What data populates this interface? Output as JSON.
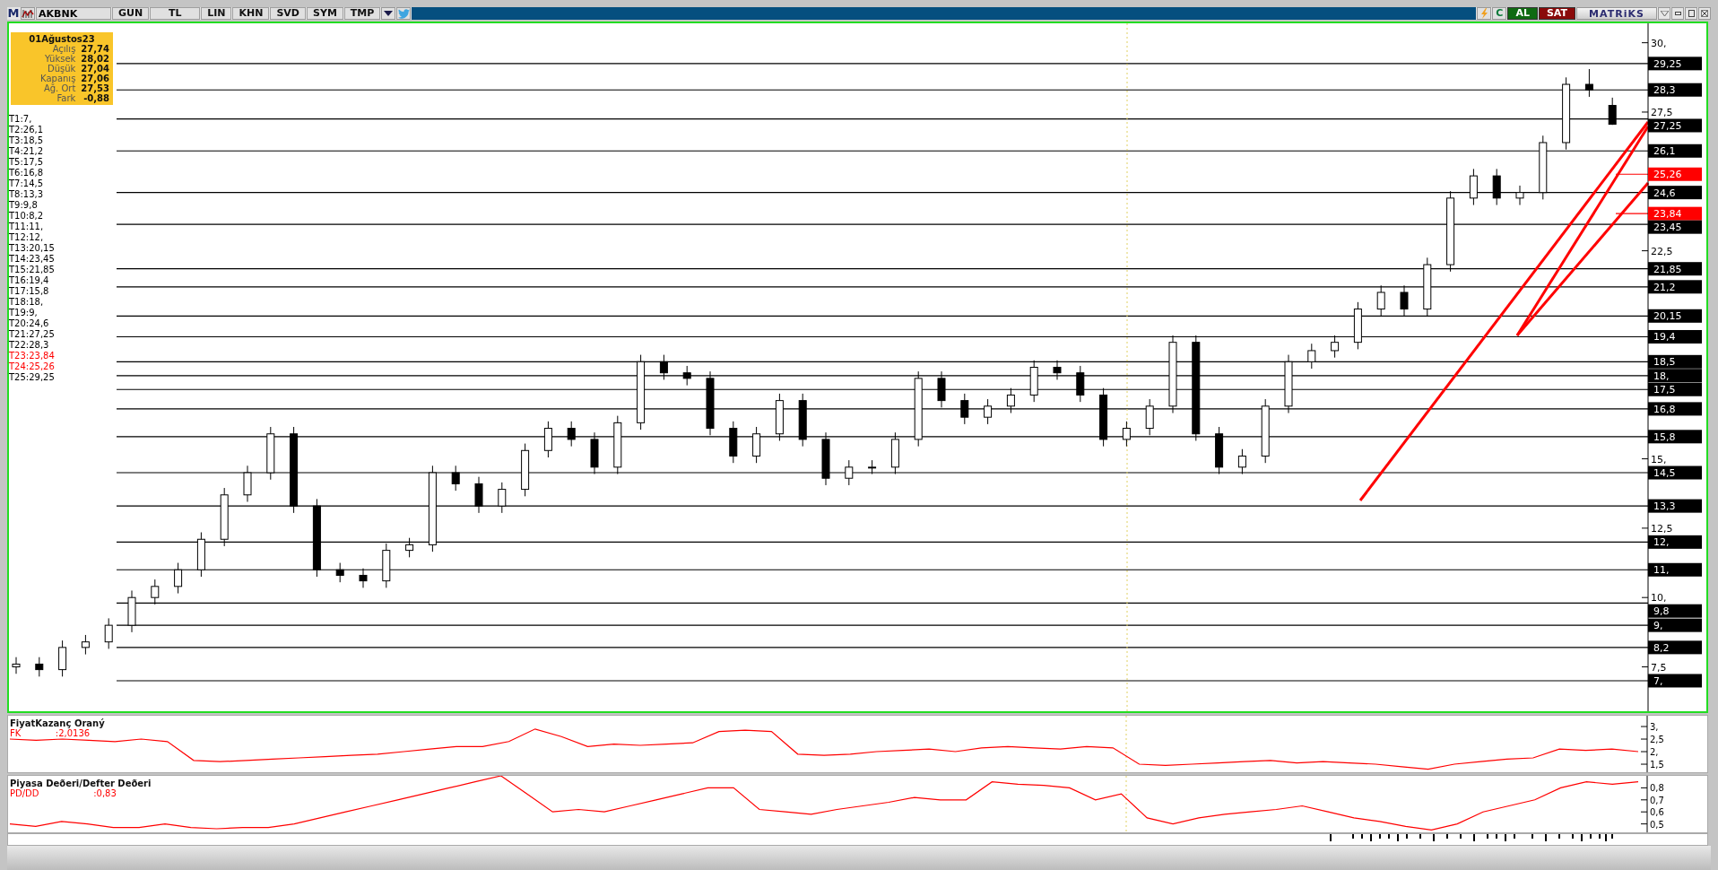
{
  "toolbar": {
    "logo": "M",
    "symbol": "AKBNK",
    "buttons": [
      "GUN",
      "TL",
      "LIN",
      "KHN",
      "SVD",
      "SYM",
      "TMP"
    ],
    "refresh": "C",
    "trade_buttons": [
      {
        "label": "AL",
        "kind": "buy"
      },
      {
        "label": "SAT",
        "kind": "sell"
      }
    ],
    "brand": "MATRiKS"
  },
  "info_box": {
    "date": "01Ağustos23",
    "rows": [
      {
        "label": "Açılış",
        "value": "27,74"
      },
      {
        "label": "Yüksek",
        "value": "28,02"
      },
      {
        "label": "Düşük",
        "value": "27,04"
      },
      {
        "label": "Kapanış",
        "value": "27,06"
      },
      {
        "label": "Ağ. Ort",
        "value": "27,53"
      },
      {
        "label": "Fark",
        "value": "-0,88"
      }
    ]
  },
  "price_chart": {
    "levels": [
      {
        "text": "T1:7,",
        "color": "#000000"
      },
      {
        "text": "T2:26,1",
        "color": "#000000"
      },
      {
        "text": "T3:18,5",
        "color": "#000000"
      },
      {
        "text": "T4:21,2",
        "color": "#000000"
      },
      {
        "text": "T5:17,5",
        "color": "#000000"
      },
      {
        "text": "T6:16,8",
        "color": "#000000"
      },
      {
        "text": "T7:14,5",
        "color": "#000000"
      },
      {
        "text": "T8:13,3",
        "color": "#000000"
      },
      {
        "text": "T9:9,8",
        "color": "#000000"
      },
      {
        "text": "T10:8,2",
        "color": "#000000"
      },
      {
        "text": "T11:11,",
        "color": "#000000"
      },
      {
        "text": "T12:12,",
        "color": "#000000"
      },
      {
        "text": "T13:20,15",
        "color": "#000000"
      },
      {
        "text": "T14:23,45",
        "color": "#000000"
      },
      {
        "text": "T15:21,85",
        "color": "#000000"
      },
      {
        "text": "T16:19,4",
        "color": "#000000"
      },
      {
        "text": "T17:15,8",
        "color": "#000000"
      },
      {
        "text": "T18:18,",
        "color": "#000000"
      },
      {
        "text": "T19:9,",
        "color": "#000000"
      },
      {
        "text": "T20:24,6",
        "color": "#000000"
      },
      {
        "text": "T21:27,25",
        "color": "#000000"
      },
      {
        "text": "T22:28,3",
        "color": "#000000"
      },
      {
        "text": "T23:23,84",
        "color": "#ff0000"
      },
      {
        "text": "T24:25,26",
        "color": "#ff0000"
      },
      {
        "text": "T25:29,25",
        "color": "#000000"
      }
    ],
    "chart_data": {
      "type": "candlestick",
      "ylim": [
        5.9,
        30.7
      ],
      "yticks": [
        {
          "value": 30,
          "label": "30,"
        },
        {
          "value": 27.5,
          "label": "27,5"
        },
        {
          "value": 22.5,
          "label": "22,5"
        },
        {
          "value": 15,
          "label": "15,"
        },
        {
          "value": 12.5,
          "label": "12,5"
        },
        {
          "value": 10,
          "label": "10,"
        },
        {
          "value": 7.5,
          "label": "7,5"
        }
      ],
      "ohlc": [
        [
          7.5,
          7.85,
          7.25,
          7.6
        ],
        [
          7.6,
          7.85,
          7.15,
          7.4
        ],
        [
          7.4,
          8.45,
          7.15,
          8.2
        ],
        [
          8.2,
          8.65,
          7.95,
          8.4
        ],
        [
          8.4,
          9.25,
          8.15,
          9
        ],
        [
          9,
          10.25,
          8.75,
          10
        ],
        [
          10,
          10.65,
          9.75,
          10.4
        ],
        [
          10.4,
          11.25,
          10.15,
          11
        ],
        [
          11,
          12.35,
          10.75,
          12.1
        ],
        [
          12.1,
          13.95,
          11.85,
          13.7
        ],
        [
          13.7,
          14.75,
          13.45,
          14.5
        ],
        [
          14.5,
          16.15,
          14.25,
          15.9
        ],
        [
          15.9,
          16.15,
          13.05,
          13.3
        ],
        [
          13.3,
          13.55,
          10.75,
          11
        ],
        [
          11,
          11.25,
          10.55,
          10.8
        ],
        [
          10.8,
          11.05,
          10.35,
          10.6
        ],
        [
          10.6,
          11.95,
          10.35,
          11.7
        ],
        [
          11.7,
          12.15,
          11.45,
          11.9
        ],
        [
          11.9,
          14.75,
          11.65,
          14.5
        ],
        [
          14.5,
          14.75,
          13.85,
          14.1
        ],
        [
          14.1,
          14.35,
          13.05,
          13.3
        ],
        [
          13.3,
          14.15,
          13.05,
          13.9
        ],
        [
          13.9,
          15.55,
          13.65,
          15.3
        ],
        [
          15.3,
          16.35,
          15.05,
          16.1
        ],
        [
          16.1,
          16.35,
          15.45,
          15.7
        ],
        [
          15.7,
          15.95,
          14.45,
          14.7
        ],
        [
          14.7,
          16.55,
          14.45,
          16.3
        ],
        [
          16.3,
          18.75,
          16.05,
          18.5
        ],
        [
          18.5,
          18.75,
          17.85,
          18.1
        ],
        [
          18.1,
          18.35,
          17.65,
          17.9
        ],
        [
          17.9,
          18.15,
          15.85,
          16.1
        ],
        [
          16.1,
          16.35,
          14.85,
          15.1
        ],
        [
          15.1,
          16.15,
          14.85,
          15.9
        ],
        [
          15.9,
          17.35,
          15.65,
          17.1
        ],
        [
          17.1,
          17.35,
          15.45,
          15.7
        ],
        [
          15.7,
          15.95,
          14.05,
          14.3
        ],
        [
          14.3,
          14.95,
          14.05,
          14.7
        ],
        [
          14.7,
          14.95,
          14.45,
          14.7
        ],
        [
          14.7,
          15.95,
          14.45,
          15.7
        ],
        [
          15.7,
          18.15,
          15.45,
          17.9
        ],
        [
          17.9,
          18.15,
          16.85,
          17.1
        ],
        [
          17.1,
          17.35,
          16.25,
          16.5
        ],
        [
          16.5,
          17.15,
          16.25,
          16.9
        ],
        [
          16.9,
          17.55,
          16.65,
          17.3
        ],
        [
          17.3,
          18.55,
          17.05,
          18.3
        ],
        [
          18.3,
          18.55,
          17.85,
          18.1
        ],
        [
          18.1,
          18.35,
          17.05,
          17.3
        ],
        [
          17.3,
          17.55,
          15.45,
          15.7
        ],
        [
          15.7,
          16.35,
          15.45,
          16.1
        ],
        [
          16.1,
          17.15,
          15.85,
          16.9
        ],
        [
          16.9,
          19.45,
          16.65,
          19.2
        ],
        [
          19.2,
          19.45,
          15.65,
          15.9
        ],
        [
          15.9,
          16.15,
          14.45,
          14.7
        ],
        [
          14.7,
          15.35,
          14.45,
          15.1
        ],
        [
          15.1,
          17.15,
          14.85,
          16.9
        ],
        [
          16.9,
          18.75,
          16.65,
          18.5
        ],
        [
          18.5,
          19.15,
          18.25,
          18.9
        ],
        [
          18.9,
          19.45,
          18.65,
          19.2
        ],
        [
          19.2,
          20.65,
          18.95,
          20.4
        ],
        [
          20.4,
          21.25,
          20.15,
          21
        ],
        [
          21,
          21.25,
          20.15,
          20.4
        ],
        [
          20.4,
          22.25,
          20.15,
          22
        ],
        [
          22,
          24.65,
          21.75,
          24.4
        ],
        [
          24.4,
          25.45,
          24.15,
          25.2
        ],
        [
          25.2,
          25.45,
          24.15,
          24.4
        ],
        [
          24.4,
          24.85,
          24.15,
          24.6
        ],
        [
          24.6,
          26.65,
          24.35,
          26.4
        ],
        [
          26.4,
          28.75,
          26.15,
          28.5
        ],
        [
          28.5,
          29.05,
          28.05,
          28.3
        ],
        [
          27.74,
          28.02,
          27.04,
          27.06
        ]
      ],
      "ref_lines": [
        {
          "axis": "y",
          "value": 7,
          "label": "7,",
          "color": "#000000"
        },
        {
          "axis": "y",
          "value": 26.1,
          "label": "26,1",
          "color": "#000000"
        },
        {
          "axis": "y",
          "value": 18.5,
          "label": "18,5",
          "color": "#000000"
        },
        {
          "axis": "y",
          "value": 21.2,
          "label": "21,2",
          "color": "#000000"
        },
        {
          "axis": "y",
          "value": 17.5,
          "label": "17,5",
          "color": "#000000"
        },
        {
          "axis": "y",
          "value": 16.8,
          "label": "16,8",
          "color": "#000000"
        },
        {
          "axis": "y",
          "value": 14.5,
          "label": "14,5",
          "color": "#000000"
        },
        {
          "axis": "y",
          "value": 13.3,
          "label": "13,3",
          "color": "#000000"
        },
        {
          "axis": "y",
          "value": 9.8,
          "label": "9,8",
          "color": "#000000"
        },
        {
          "axis": "y",
          "value": 8.2,
          "label": "8,2",
          "color": "#000000"
        },
        {
          "axis": "y",
          "value": 11,
          "label": "11,",
          "color": "#000000"
        },
        {
          "axis": "y",
          "value": 12,
          "label": "12,",
          "color": "#000000"
        },
        {
          "axis": "y",
          "value": 20.15,
          "label": "20,15",
          "color": "#000000"
        },
        {
          "axis": "y",
          "value": 23.45,
          "label": "23,45",
          "color": "#000000"
        },
        {
          "axis": "y",
          "value": 21.85,
          "label": "21,85",
          "color": "#000000"
        },
        {
          "axis": "y",
          "value": 19.4,
          "label": "19,4",
          "color": "#000000"
        },
        {
          "axis": "y",
          "value": 15.8,
          "label": "15,8",
          "color": "#000000"
        },
        {
          "axis": "y",
          "value": 18,
          "label": "18,",
          "color": "#000000"
        },
        {
          "axis": "y",
          "value": 9,
          "label": "9,",
          "color": "#000000"
        },
        {
          "axis": "y",
          "value": 24.6,
          "label": "24,6",
          "color": "#000000"
        },
        {
          "axis": "y",
          "value": 27.25,
          "label": "27,25",
          "color": "#000000"
        },
        {
          "axis": "y",
          "value": 28.3,
          "label": "28,3",
          "color": "#000000"
        },
        {
          "axis": "y",
          "value": 23.84,
          "label": "23,84",
          "color": "#ff0000"
        },
        {
          "axis": "y",
          "value": 25.26,
          "label": "25,26",
          "color": "#ff0000"
        },
        {
          "axis": "y",
          "value": 29.25,
          "label": "29,25",
          "color": "#000000"
        }
      ]
    }
  },
  "indicators": [
    {
      "title": "FiyatKazanç Oraný",
      "reading": ":2,0136",
      "chart_data": {
        "type": "line",
        "ylim": [
          1.18,
          3.43
        ],
        "yticks": [
          {
            "value": 3,
            "label": "3,"
          },
          {
            "value": 2.5,
            "label": "2,5"
          },
          {
            "value": 2,
            "label": "2,"
          },
          {
            "value": 1.5,
            "label": "1,5"
          }
        ],
        "series": [
          {
            "name": "FK",
            "color": "#ff0000",
            "values": [
              2.5,
              2.45,
              2.5,
              2.45,
              2.4,
              2.5,
              2.4,
              1.65,
              1.6,
              1.65,
              1.7,
              1.75,
              1.8,
              1.85,
              1.9,
              2.0,
              2.1,
              2.2,
              2.2,
              2.4,
              2.9,
              2.6,
              2.2,
              2.3,
              2.25,
              2.3,
              2.35,
              2.8,
              2.85,
              2.8,
              1.9,
              1.85,
              1.9,
              2.0,
              2.05,
              2.1,
              2.0,
              2.15,
              2.2,
              2.15,
              2.1,
              2.2,
              2.15,
              1.5,
              1.45,
              1.5,
              1.55,
              1.6,
              1.65,
              1.55,
              1.6,
              1.55,
              1.5,
              1.4,
              1.3,
              1.5,
              1.6,
              1.7,
              1.75,
              2.1,
              2.05,
              2.1,
              2.0
            ]
          }
        ]
      }
    },
    {
      "title": "Piyasa Deðeri/Defter Deðeri",
      "reading": ":0,83",
      "chart_data": {
        "type": "line",
        "ylim": [
          0.43,
          0.9
        ],
        "yticks": [
          {
            "value": 0.8,
            "label": "0,8"
          },
          {
            "value": 0.7,
            "label": "0,7"
          },
          {
            "value": 0.6,
            "label": "0,6"
          },
          {
            "value": 0.5,
            "label": "0,5"
          }
        ],
        "series": [
          {
            "name": "PD/DD",
            "color": "#ff0000",
            "values": [
              0.5,
              0.48,
              0.52,
              0.5,
              0.47,
              0.47,
              0.5,
              0.47,
              0.46,
              0.47,
              0.47,
              0.5,
              0.55,
              0.6,
              0.65,
              0.7,
              0.75,
              0.8,
              0.85,
              0.9,
              0.75,
              0.6,
              0.62,
              0.6,
              0.65,
              0.7,
              0.75,
              0.8,
              0.8,
              0.62,
              0.6,
              0.58,
              0.62,
              0.65,
              0.68,
              0.72,
              0.7,
              0.7,
              0.85,
              0.83,
              0.82,
              0.8,
              0.7,
              0.75,
              0.55,
              0.5,
              0.55,
              0.58,
              0.6,
              0.62,
              0.65,
              0.6,
              0.55,
              0.52,
              0.48,
              0.45,
              0.5,
              0.6,
              0.65,
              0.7,
              0.8,
              0.85,
              0.83,
              0.85
            ]
          }
        ]
      }
    }
  ]
}
